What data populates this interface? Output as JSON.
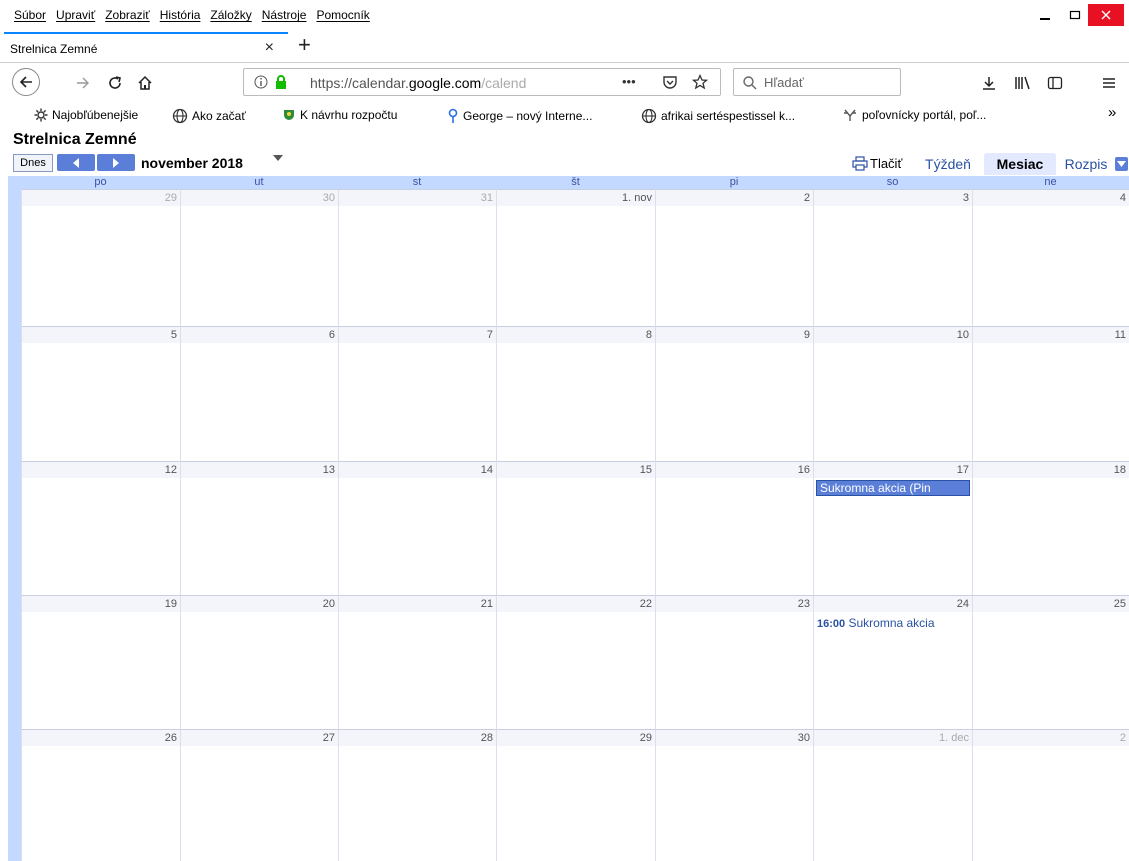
{
  "menu": [
    "Súbor",
    "Upraviť",
    "Zobraziť",
    "História",
    "Záložky",
    "Nástroje",
    "Pomocník"
  ],
  "tab": {
    "title": "Strelnica Zemné",
    "close": "×",
    "new": "+"
  },
  "urlbar": {
    "prefix": "https://calendar.",
    "domain": "google.com",
    "suffix": "/calend",
    "more": "•••"
  },
  "search": {
    "placeholder": "Hľadať"
  },
  "bookmarks": [
    {
      "label": "Najobľúbenejšie",
      "icon": "gear-icon"
    },
    {
      "label": "Ako začať",
      "icon": "globe-icon"
    },
    {
      "label": "K návrhu rozpočtu",
      "icon": "crest-icon"
    },
    {
      "label": "George – nový Interne...",
      "icon": "george-icon"
    },
    {
      "label": "afrikai sertéspestissel k...",
      "icon": "globe-icon"
    },
    {
      "label": "poľovnícky portál, poľ...",
      "icon": "antler-icon"
    }
  ],
  "bookmarks_more": "»",
  "calendar": {
    "title": "Strelnica Zemné",
    "today": "Dnes",
    "month": "november 2018",
    "print": "Tlačiť",
    "views": {
      "week": "Týždeň",
      "month": "Mesiac",
      "agenda": "Rozpis"
    },
    "weekdays": [
      "po",
      "ut",
      "st",
      "št",
      "pi",
      "so",
      "ne"
    ],
    "weeks": [
      [
        "29",
        "30",
        "31",
        "1. nov",
        "2",
        "3",
        "4"
      ],
      [
        "5",
        "6",
        "7",
        "8",
        "9",
        "10",
        "11"
      ],
      [
        "12",
        "13",
        "14",
        "15",
        "16",
        "17",
        "18"
      ],
      [
        "19",
        "20",
        "21",
        "22",
        "23",
        "24",
        "25"
      ],
      [
        "26",
        "27",
        "28",
        "29",
        "30",
        "1. dec",
        "2"
      ]
    ],
    "events": {
      "allday": {
        "label": "Sukromna akcia (Pin"
      },
      "timed": {
        "time": "16:00",
        "label": "Sukromna akcia"
      }
    }
  }
}
